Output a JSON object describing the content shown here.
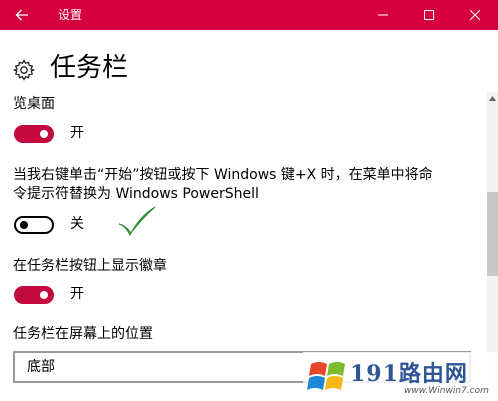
{
  "window": {
    "title": "设置",
    "accent_color": "#d6003f",
    "controls": [
      "minimize",
      "maximize",
      "close"
    ]
  },
  "page": {
    "title": "任务栏",
    "icon": "gear-icon"
  },
  "settings": [
    {
      "label": "览桌面",
      "state_label": "开",
      "on": true
    },
    {
      "label_line1": "当我右键单击“开始”按钮或按下 Windows 键+X 时，在菜单中将命",
      "label_line2": "令提示符替换为 Windows PowerShell",
      "state_label": "关",
      "on": false
    },
    {
      "label": "在任务栏按钮上显示徽章",
      "state_label": "开",
      "on": true
    }
  ],
  "position_setting": {
    "label": "任务栏在屏幕上的位置",
    "value": "底部"
  },
  "watermark": {
    "brand": "191路由网",
    "url": "www.Winwin7.com"
  },
  "colors": {
    "toggle_on": "#c30a3e",
    "checkmark": "#3aa63a"
  }
}
